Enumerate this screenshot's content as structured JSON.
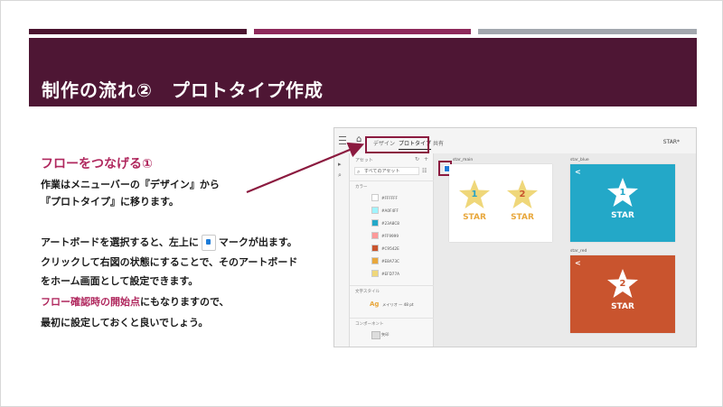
{
  "slide": {
    "title": "制作の流れ②　プロトタイプ作成"
  },
  "colors": {
    "title_band": "#4e1634",
    "accent_pink": "#b0285e",
    "highlight_box": "#8b1a3f",
    "artboard_blue": "#23a8c8",
    "artboard_red": "#c9542e",
    "star_yellow": "#efd77a"
  },
  "body": {
    "heading": "フローをつなげる①",
    "line1": "作業はメニューバーの『デザイン』から",
    "line2": "『プロトタイプ』に移ります。",
    "line3_before": "アートボードを選択すると、左上に",
    "line3_icon": "home-marker-icon",
    "line3_after": "マークが出ます。",
    "line4": "クリックして右図の状態にすることで、そのアートボード",
    "line5": "をホーム画面として設定できます。",
    "line6_highlight": "フロー確認時の開始点",
    "line6_rest": "にもなりますので、",
    "line7": "最初に設定しておくと良いでしょう。"
  },
  "xd": {
    "tabs": [
      "デザイン",
      "プロトタイプ",
      "共有"
    ],
    "active_tab": "プロトタイプ",
    "doc_name": "STAR*",
    "panel": {
      "title": "アセット",
      "search": "すべてのアセット",
      "colors_label": "カラー",
      "swatches": [
        {
          "hex": "#FFFFFF",
          "label": "#FFFFFF"
        },
        {
          "hex": "#A0F4FF",
          "label": "#A0F4FF"
        },
        {
          "hex": "#23A8C8",
          "label": "#23A8C8"
        },
        {
          "hex": "#FF9999",
          "label": "#FF9999"
        },
        {
          "hex": "#C9542E",
          "label": "#C9542E"
        },
        {
          "hex": "#E8A73C",
          "label": "#E8A73C"
        },
        {
          "hex": "#EFD77A",
          "label": "#EFD77A"
        }
      ],
      "char_styles_label": "文字スタイル",
      "char_style_sample": "Ag",
      "char_style_name": "メイリオ — 48 pt",
      "components_label": "コンポーネント",
      "component_name": "矢印"
    },
    "artboards": {
      "main_label": "star_main",
      "blue_label": "star_blue",
      "red_label": "star_red",
      "star_word": "STAR",
      "main_num1": "1",
      "main_num2": "2",
      "blue_num": "1",
      "red_num": "2",
      "back_icon": "<"
    }
  }
}
